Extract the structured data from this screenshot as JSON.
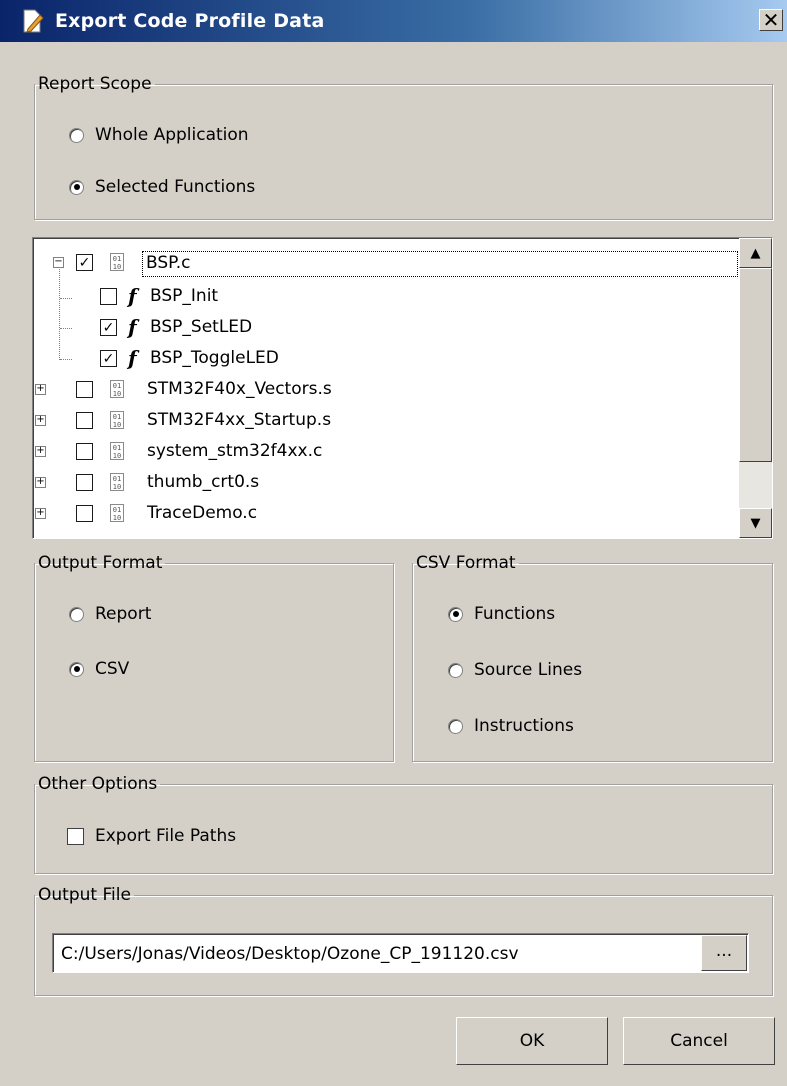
{
  "window": {
    "title": "Export Code Profile Data",
    "close_label": "✕"
  },
  "report_scope": {
    "legend": "Report Scope",
    "options": [
      {
        "label": "Whole Application",
        "selected": false
      },
      {
        "label": "Selected Functions",
        "selected": true
      }
    ]
  },
  "tree": {
    "items": [
      {
        "label": "BSP.c",
        "type": "file",
        "checked": true,
        "expander": "−"
      },
      {
        "label": "BSP_Init",
        "type": "function",
        "checked": false
      },
      {
        "label": "BSP_SetLED",
        "type": "function",
        "checked": true
      },
      {
        "label": "BSP_ToggleLED",
        "type": "function",
        "checked": true
      },
      {
        "label": "STM32F40x_Vectors.s",
        "type": "file",
        "checked": false,
        "expander": "+"
      },
      {
        "label": "STM32F4xx_Startup.s",
        "type": "file",
        "checked": false,
        "expander": "+"
      },
      {
        "label": "system_stm32f4xx.c",
        "type": "file",
        "checked": false,
        "expander": "+"
      },
      {
        "label": "thumb_crt0.s",
        "type": "file",
        "checked": false,
        "expander": "+"
      },
      {
        "label": "TraceDemo.c",
        "type": "file",
        "checked": false,
        "expander": "+"
      }
    ],
    "fn_glyph": "f",
    "file_glyph": "01\n10",
    "scroll_up": "▲",
    "scroll_down": "▼"
  },
  "output_format": {
    "legend": "Output Format",
    "options": [
      {
        "label": "Report",
        "selected": false
      },
      {
        "label": "CSV",
        "selected": true
      }
    ]
  },
  "csv_format": {
    "legend": "CSV Format",
    "options": [
      {
        "label": "Functions",
        "selected": true
      },
      {
        "label": "Source Lines",
        "selected": false
      },
      {
        "label": "Instructions",
        "selected": false
      }
    ]
  },
  "other_options": {
    "legend": "Other Options",
    "export_file_paths": {
      "label": "Export File Paths",
      "checked": false
    }
  },
  "output_file": {
    "legend": "Output File",
    "path": "C:/Users/Jonas/Videos/Desktop/Ozone_CP_191120.csv",
    "browse_label": "..."
  },
  "buttons": {
    "ok": "OK",
    "cancel": "Cancel"
  }
}
